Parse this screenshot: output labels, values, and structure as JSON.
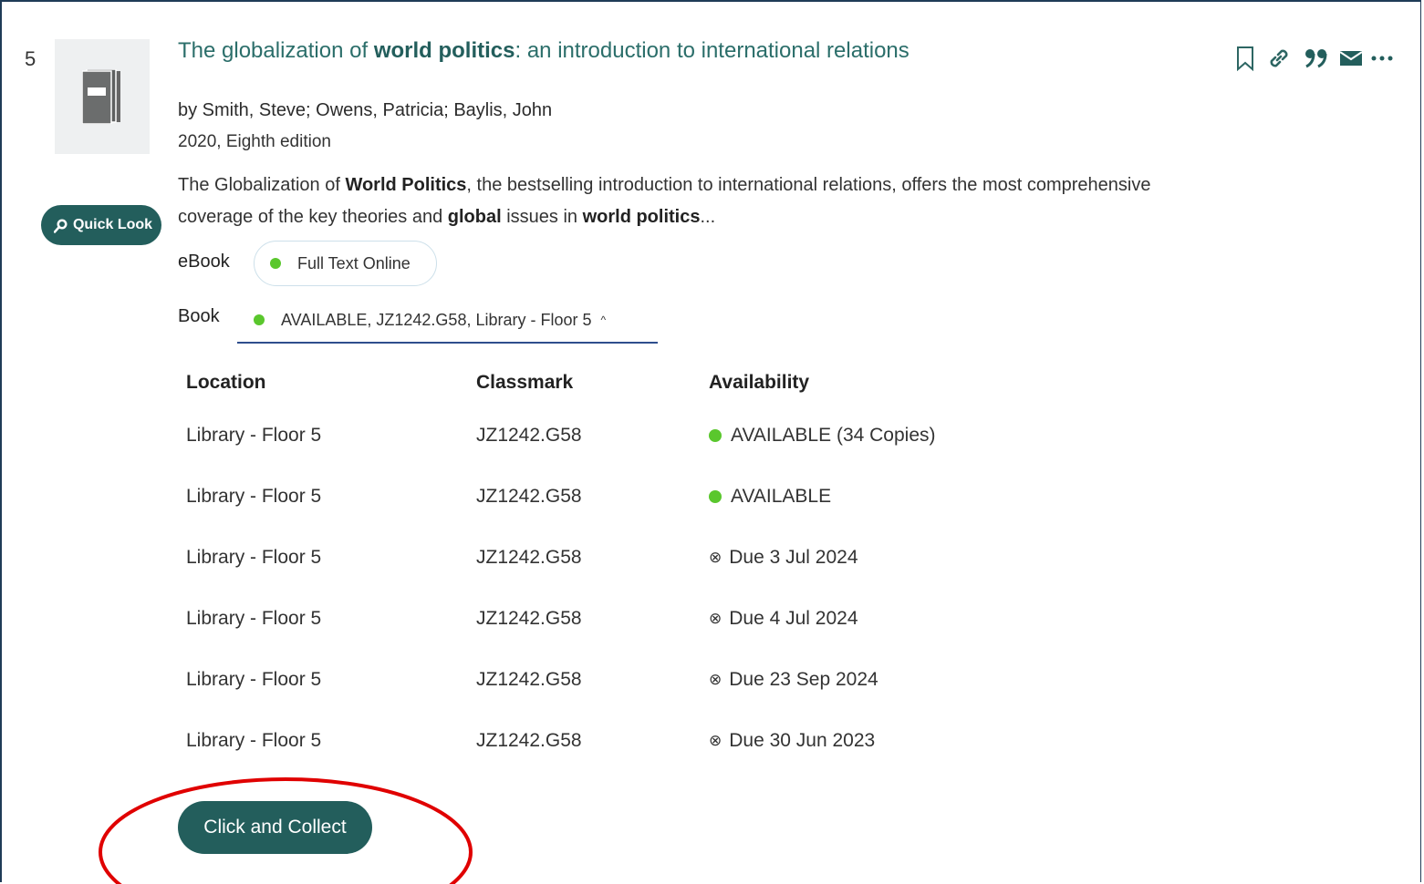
{
  "result": {
    "number": "5",
    "title_pre": "The globalization of ",
    "title_bold": "world politics",
    "title_post": ": an introduction to international relations",
    "authors": "by Smith, Steve; Owens, Patricia; Baylis, John",
    "edition": "2020, Eighth edition",
    "description_parts": [
      {
        "text": "The Globalization of ",
        "bold": false
      },
      {
        "text": "World Politics",
        "bold": true
      },
      {
        "text": ", the bestselling introduction to international relations, offers the most comprehensive coverage of the key theories and ",
        "bold": false
      },
      {
        "text": "global",
        "bold": true
      },
      {
        "text": " issues in ",
        "bold": false
      },
      {
        "text": "world politics",
        "bold": true
      },
      {
        "text": "...",
        "bold": false
      }
    ],
    "quick_look_label": "Quick Look",
    "thumbnail_icon": "book-icon"
  },
  "actions": [
    {
      "name": "bookmark-icon"
    },
    {
      "name": "link-icon"
    },
    {
      "name": "cite-quote-icon"
    },
    {
      "name": "email-icon"
    },
    {
      "name": "more-icon"
    }
  ],
  "ebook": {
    "label": "eBook",
    "status": "Full Text Online"
  },
  "book": {
    "label": "Book",
    "status": "AVAILABLE, JZ1242.G58, Library - Floor 5",
    "chevron": "^"
  },
  "holdings": {
    "headers": {
      "location": "Location",
      "classmark": "Classmark",
      "availability": "Availability"
    },
    "rows": [
      {
        "location": "Library - Floor 5",
        "classmark": "JZ1242.G58",
        "availability": "AVAILABLE (34 Copies)",
        "status": "available"
      },
      {
        "location": "Library - Floor 5",
        "classmark": "JZ1242.G58",
        "availability": "AVAILABLE",
        "status": "available"
      },
      {
        "location": "Library - Floor 5",
        "classmark": "JZ1242.G58",
        "availability": "Due 3 Jul 2024",
        "status": "due"
      },
      {
        "location": "Library - Floor 5",
        "classmark": "JZ1242.G58",
        "availability": "Due 4 Jul 2024",
        "status": "due"
      },
      {
        "location": "Library - Floor 5",
        "classmark": "JZ1242.G58",
        "availability": "Due 23 Sep 2024",
        "status": "due"
      },
      {
        "location": "Library - Floor 5",
        "classmark": "JZ1242.G58",
        "availability": "Due 30 Jun 2023",
        "status": "due"
      }
    ]
  },
  "click_collect_label": "Click and Collect",
  "colors": {
    "accent": "#235e5c",
    "available": "#5ac72d",
    "tab_underline": "#2e4e8d",
    "annotation": "#e00000"
  }
}
